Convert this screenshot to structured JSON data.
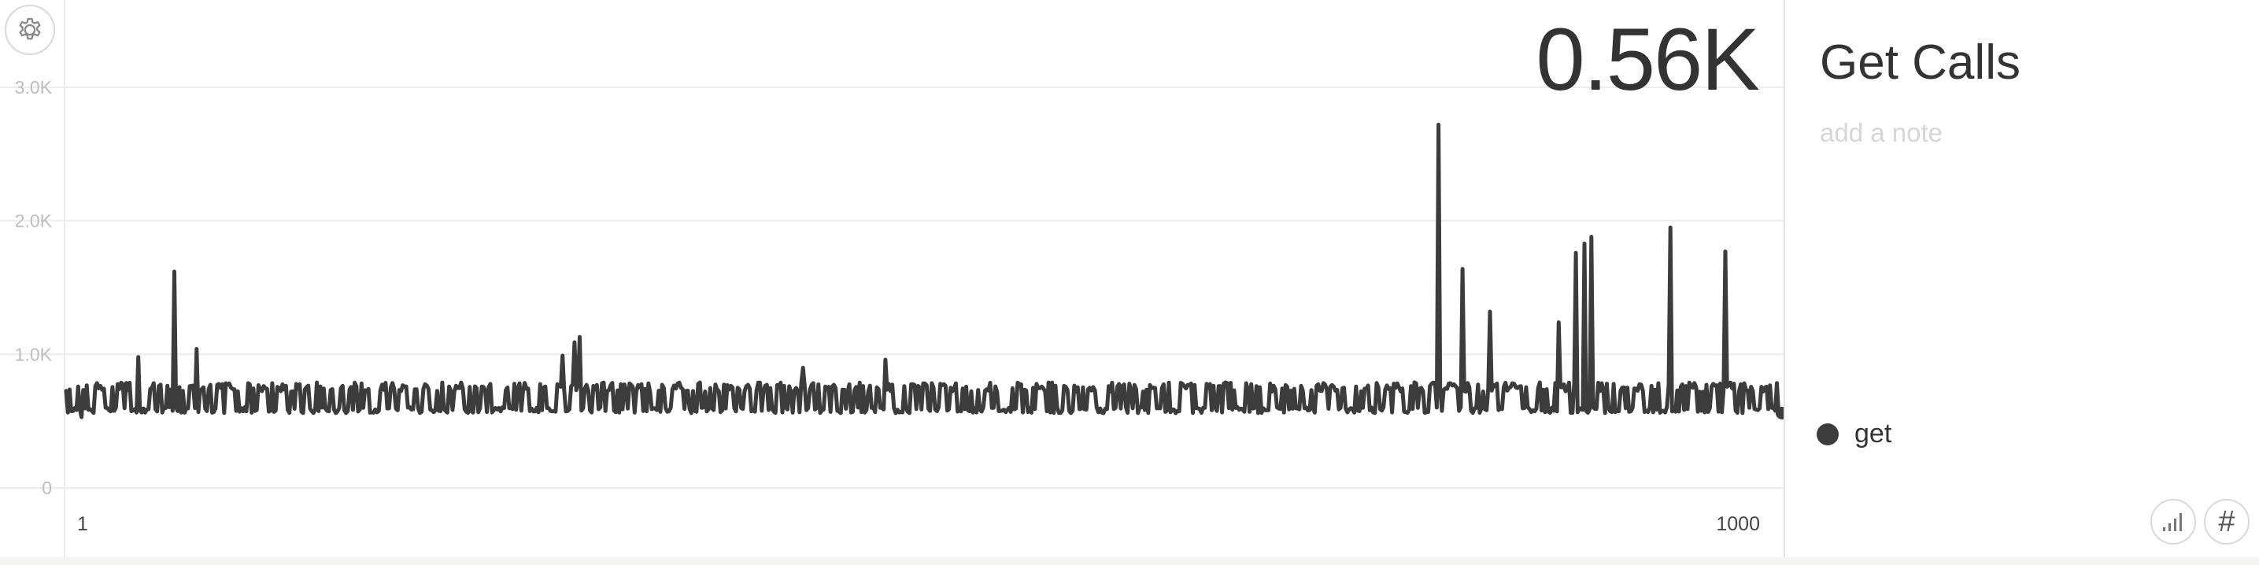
{
  "header": {
    "value": "0.56K"
  },
  "panel": {
    "title": "Get Calls",
    "note_placeholder": "add a note"
  },
  "controls": {
    "settings_icon": "gear-icon",
    "stats_icon": "bar-chart-icon",
    "hash_label": "#"
  },
  "chart_data": {
    "type": "line",
    "title": "Get Calls",
    "xlabel": "",
    "ylabel": "",
    "x_ticks": [
      "1",
      "1000"
    ],
    "y_ticks": [
      "0",
      "1.0K",
      "2.0K",
      "3.0K"
    ],
    "xlim": [
      1,
      1000
    ],
    "ylim": [
      0,
      3300
    ],
    "grid": "horizontal",
    "color": "#3c3c3c",
    "legend_position": "right",
    "series": [
      {
        "name": "get",
        "baseline": [
          560,
          790
        ],
        "spikes": [
          {
            "x": 10,
            "y": 530
          },
          {
            "x": 43,
            "y": 980
          },
          {
            "x": 64,
            "y": 1620
          },
          {
            "x": 77,
            "y": 1040
          },
          {
            "x": 290,
            "y": 990
          },
          {
            "x": 297,
            "y": 1090
          },
          {
            "x": 300,
            "y": 1130
          },
          {
            "x": 430,
            "y": 900
          },
          {
            "x": 478,
            "y": 960
          },
          {
            "x": 800,
            "y": 2720
          },
          {
            "x": 814,
            "y": 1640
          },
          {
            "x": 830,
            "y": 1320
          },
          {
            "x": 870,
            "y": 1240
          },
          {
            "x": 880,
            "y": 1760
          },
          {
            "x": 885,
            "y": 1830
          },
          {
            "x": 889,
            "y": 1880
          },
          {
            "x": 935,
            "y": 1950
          },
          {
            "x": 967,
            "y": 1770
          }
        ],
        "last_value": 560
      }
    ]
  }
}
